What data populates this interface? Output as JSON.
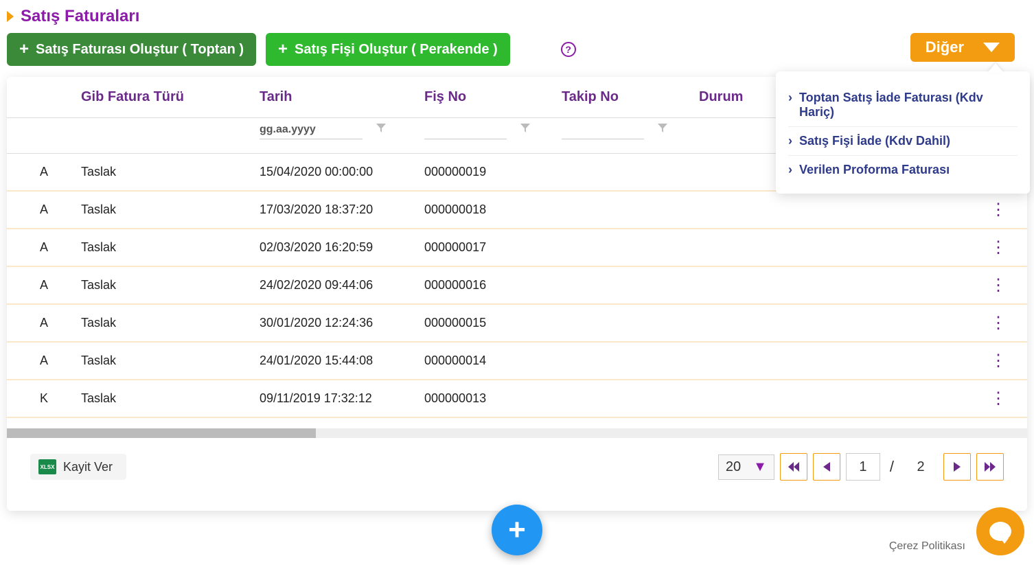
{
  "page_title": "Satış Faturaları",
  "buttons": {
    "create_toptan": "Satış Faturası Oluştur ( Toptan )",
    "create_perakende": "Satış Fişi Oluştur ( Perakende )",
    "diger": "Diğer"
  },
  "dropdown_items": [
    "Toptan Satış İade Faturası (Kdv Hariç)",
    "Satış Fişi İade (Kdv Dahil)",
    "Verilen Proforma Faturası"
  ],
  "columns": {
    "gib": "Gib Fatura Türü",
    "tarih": "Tarih",
    "fis": "Fiş No",
    "takip": "Takip No",
    "durum": "Durum"
  },
  "filters": {
    "tarih_placeholder": "gg.aa.yyyy"
  },
  "rows": [
    {
      "code": "A",
      "gib": "Taslak",
      "tarih": "15/04/2020 00:00:00",
      "fis": "000000019",
      "takip": "",
      "show_kebab": false
    },
    {
      "code": "A",
      "gib": "Taslak",
      "tarih": "17/03/2020 18:37:20",
      "fis": "000000018",
      "takip": "",
      "show_kebab": true
    },
    {
      "code": "A",
      "gib": "Taslak",
      "tarih": "02/03/2020 16:20:59",
      "fis": "000000017",
      "takip": "",
      "show_kebab": true
    },
    {
      "code": "A",
      "gib": "Taslak",
      "tarih": "24/02/2020 09:44:06",
      "fis": "000000016",
      "takip": "",
      "show_kebab": true
    },
    {
      "code": "A",
      "gib": "Taslak",
      "tarih": "30/01/2020 12:24:36",
      "fis": "000000015",
      "takip": "",
      "show_kebab": true
    },
    {
      "code": "A",
      "gib": "Taslak",
      "tarih": "24/01/2020 15:44:08",
      "fis": "000000014",
      "takip": "",
      "show_kebab": true
    },
    {
      "code": "K",
      "gib": "Taslak",
      "tarih": "09/11/2019 17:32:12",
      "fis": "000000013",
      "takip": "",
      "show_kebab": true
    }
  ],
  "export": {
    "label": "Kayit Ver",
    "icon_text": "XLSX"
  },
  "pagination": {
    "page_size": "20",
    "current": "1",
    "total": "2",
    "separator": "/"
  },
  "cookie_label": "Çerez Politikası"
}
